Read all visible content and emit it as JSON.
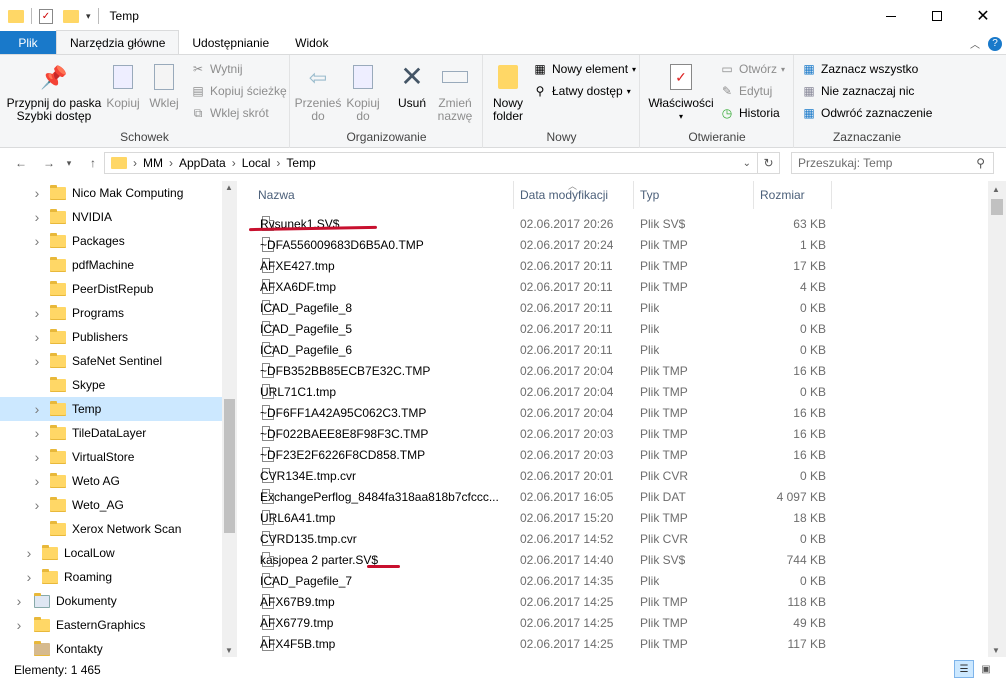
{
  "window": {
    "title": "Temp"
  },
  "ribbon_tabs": [
    {
      "label": "Plik"
    },
    {
      "label": "Narzędzia główne"
    },
    {
      "label": "Udostępnianie"
    },
    {
      "label": "Widok"
    }
  ],
  "ribbon": {
    "schowek": {
      "label": "Schowek",
      "pin": "Przypnij do paska Szybki dostęp",
      "copy": "Kopiuj",
      "paste": "Wklej",
      "cut": "Wytnij",
      "copy_path": "Kopiuj ścieżkę",
      "paste_shortcut": "Wklej skrót"
    },
    "organizowanie": {
      "label": "Organizowanie",
      "move_to": "Przenieś do",
      "copy_to": "Kopiuj do",
      "delete": "Usuń",
      "rename": "Zmień nazwę"
    },
    "nowy": {
      "label": "Nowy",
      "new_folder": "Nowy folder",
      "new_item": "Nowy element",
      "easy_access": "Łatwy dostęp"
    },
    "otwieranie": {
      "label": "Otwieranie",
      "properties": "Właściwości",
      "open": "Otwórz",
      "edit": "Edytuj",
      "history": "Historia"
    },
    "zaznaczanie": {
      "label": "Zaznaczanie",
      "select_all": "Zaznacz wszystko",
      "select_none": "Nie zaznaczaj nic",
      "invert": "Odwróć zaznaczenie"
    }
  },
  "address": {
    "crumbs": [
      "MM",
      "AppData",
      "Local",
      "Temp"
    ],
    "search_placeholder": "Przeszukaj: Temp"
  },
  "nav_tree": [
    {
      "label": "Nico Mak Computing",
      "expandable": true
    },
    {
      "label": "NVIDIA",
      "expandable": true
    },
    {
      "label": "Packages",
      "expandable": true
    },
    {
      "label": "pdfMachine",
      "expandable": false
    },
    {
      "label": "PeerDistRepub",
      "expandable": false
    },
    {
      "label": "Programs",
      "expandable": true
    },
    {
      "label": "Publishers",
      "expandable": true
    },
    {
      "label": "SafeNet Sentinel",
      "expandable": true
    },
    {
      "label": "Skype",
      "expandable": false
    },
    {
      "label": "Temp",
      "expandable": true,
      "selected": true
    },
    {
      "label": "TileDataLayer",
      "expandable": true
    },
    {
      "label": "VirtualStore",
      "expandable": true
    },
    {
      "label": "Weto AG",
      "expandable": true
    },
    {
      "label": "Weto_AG",
      "expandable": true
    },
    {
      "label": "Xerox Network Scan",
      "expandable": false
    },
    {
      "label": "LocalLow",
      "expandable": true,
      "level": 1
    },
    {
      "label": "Roaming",
      "expandable": true,
      "level": 1
    },
    {
      "label": "Dokumenty",
      "expandable": true,
      "level": 0,
      "icon": "document-library-icon"
    },
    {
      "label": "EasternGraphics",
      "expandable": true,
      "level": 0
    },
    {
      "label": "Kontakty",
      "expandable": false,
      "level": 0,
      "icon": "contacts-icon"
    }
  ],
  "columns": {
    "name": "Nazwa",
    "date": "Data modyfikacji",
    "type": "Typ",
    "size": "Rozmiar"
  },
  "files": [
    {
      "name": "Rysunek1.SV$",
      "date": "02.06.2017 20:26",
      "type": "Plik SV$",
      "size": "63 KB"
    },
    {
      "name": "~DFA556009683D6B5A0.TMP",
      "date": "02.06.2017 20:24",
      "type": "Plik TMP",
      "size": "1 KB"
    },
    {
      "name": "AFXE427.tmp",
      "date": "02.06.2017 20:11",
      "type": "Plik TMP",
      "size": "17 KB"
    },
    {
      "name": "AFXA6DF.tmp",
      "date": "02.06.2017 20:11",
      "type": "Plik TMP",
      "size": "4 KB"
    },
    {
      "name": "ICAD_Pagefile_8",
      "date": "02.06.2017 20:11",
      "type": "Plik",
      "size": "0 KB"
    },
    {
      "name": "ICAD_Pagefile_5",
      "date": "02.06.2017 20:11",
      "type": "Plik",
      "size": "0 KB"
    },
    {
      "name": "ICAD_Pagefile_6",
      "date": "02.06.2017 20:11",
      "type": "Plik",
      "size": "0 KB"
    },
    {
      "name": "~DFB352BB85ECB7E32C.TMP",
      "date": "02.06.2017 20:04",
      "type": "Plik TMP",
      "size": "16 KB"
    },
    {
      "name": "URL71C1.tmp",
      "date": "02.06.2017 20:04",
      "type": "Plik TMP",
      "size": "0 KB"
    },
    {
      "name": "~DF6FF1A42A95C062C3.TMP",
      "date": "02.06.2017 20:04",
      "type": "Plik TMP",
      "size": "16 KB"
    },
    {
      "name": "~DF022BAEE8E8F98F3C.TMP",
      "date": "02.06.2017 20:03",
      "type": "Plik TMP",
      "size": "16 KB"
    },
    {
      "name": "~DF23E2F6226F8CD858.TMP",
      "date": "02.06.2017 20:03",
      "type": "Plik TMP",
      "size": "16 KB"
    },
    {
      "name": "CVR134E.tmp.cvr",
      "date": "02.06.2017 20:01",
      "type": "Plik CVR",
      "size": "0 KB"
    },
    {
      "name": "ExchangePerflog_8484fa318aa818b7cfccc...",
      "date": "02.06.2017 16:05",
      "type": "Plik DAT",
      "size": "4 097 KB"
    },
    {
      "name": "URL6A41.tmp",
      "date": "02.06.2017 15:20",
      "type": "Plik TMP",
      "size": "18 KB"
    },
    {
      "name": "CVRD135.tmp.cvr",
      "date": "02.06.2017 14:52",
      "type": "Plik CVR",
      "size": "0 KB"
    },
    {
      "name": "kasjopea 2 parter.SV$",
      "date": "02.06.2017 14:40",
      "type": "Plik SV$",
      "size": "744 KB"
    },
    {
      "name": "ICAD_Pagefile_7",
      "date": "02.06.2017 14:35",
      "type": "Plik",
      "size": "0 KB"
    },
    {
      "name": "AFX67B9.tmp",
      "date": "02.06.2017 14:25",
      "type": "Plik TMP",
      "size": "118 KB"
    },
    {
      "name": "AFX6779.tmp",
      "date": "02.06.2017 14:25",
      "type": "Plik TMP",
      "size": "49 KB"
    },
    {
      "name": "AFX4F5B.tmp",
      "date": "02.06.2017 14:25",
      "type": "Plik TMP",
      "size": "117 KB"
    }
  ],
  "status": {
    "items": "Elementy: 1 465"
  },
  "colors": {
    "accent": "#1979ca",
    "selection": "#cce8ff",
    "annotation": "#c8102e",
    "folder": "#ffd766"
  }
}
